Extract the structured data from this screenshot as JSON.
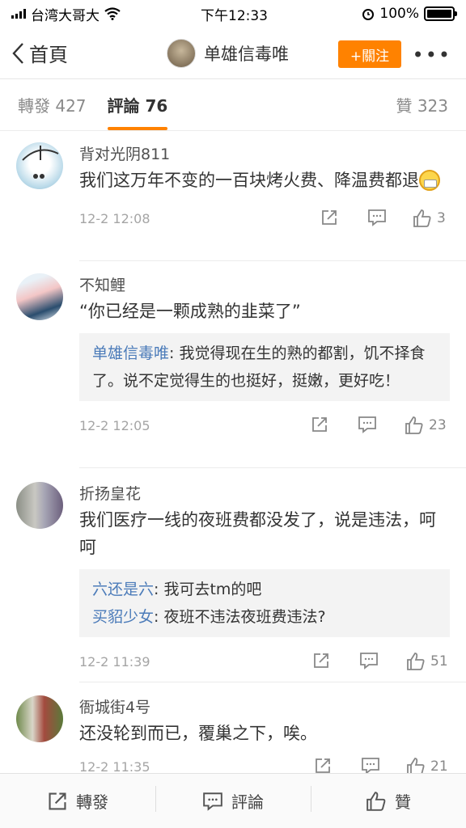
{
  "status_bar": {
    "carrier": "台湾大哥大",
    "time": "下午12:33",
    "battery": "100%"
  },
  "nav": {
    "back_label": "首頁",
    "title": "单雄信毒唯",
    "follow_label": "+關注",
    "more_label": "•••"
  },
  "tabs": {
    "repost": "轉發 427",
    "comments": "評論 76",
    "likes": "贊 323"
  },
  "comments": [
    {
      "name": "背对光阴811",
      "text": "我们这万年不变的一百块烤火费、降温费都退",
      "time": "12-2 12:08",
      "likes": "3"
    },
    {
      "name": "不知鲤",
      "text": "“你已经是一颗成熟的韭菜了”",
      "reply_name": "单雄信毒唯",
      "reply_text": ": 我觉得现在生的熟的都割，饥不择食了。说不定觉得生的也挺好，挺嫩，更好吃！",
      "time": "12-2 12:05",
      "likes": "23"
    },
    {
      "name": "折扬皇花",
      "text": "我们医疗一线的夜班费都没发了，说是违法，呵呵",
      "replies": [
        {
          "name": "六还是六",
          "text": ": 我可去tm的吧"
        },
        {
          "name": "买貂少女",
          "text": ": 夜班不违法夜班费违法?"
        }
      ],
      "time": "12-2 11:39",
      "likes": "51"
    },
    {
      "name": "衙城街4号",
      "text": "还没轮到而已，覆巢之下，唉。",
      "time": "12-2 11:35",
      "likes": "21"
    }
  ],
  "bottom_bar": {
    "repost": "轉發",
    "comment": "評論",
    "like": "贊"
  }
}
